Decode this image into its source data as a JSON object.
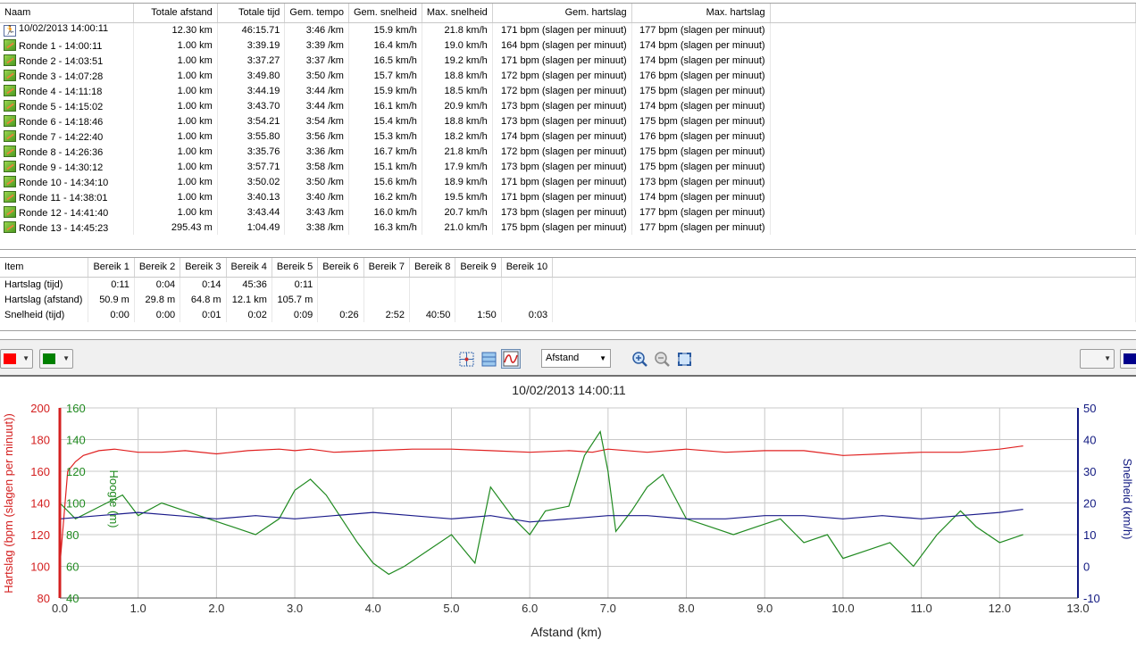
{
  "laps": {
    "columns": [
      "Naam",
      "Totale afstand",
      "Totale tijd",
      "Gem. tempo",
      "Gem. snelheid",
      "Max. snelheid",
      "Gem. hartslag",
      "Max. hartslag"
    ],
    "rows": [
      {
        "name": "10/02/2013 14:00:11",
        "dist": "12.30 km",
        "time": "46:15.71",
        "pace": "3:46 /km",
        "avg_speed": "15.9 km/h",
        "max_speed": "21.8 km/h",
        "avg_hr": "171 bpm (slagen per minuut)",
        "max_hr": "177 bpm (slagen per minuut)",
        "icon": "runner-icon"
      },
      {
        "name": "Ronde 1 - 14:00:11",
        "dist": "1.00 km",
        "time": "3:39.19",
        "pace": "3:39 /km",
        "avg_speed": "16.4 km/h",
        "max_speed": "19.0 km/h",
        "avg_hr": "164 bpm (slagen per minuut)",
        "max_hr": "174 bpm (slagen per minuut)",
        "icon": "lap-icon"
      },
      {
        "name": "Ronde 2 - 14:03:51",
        "dist": "1.00 km",
        "time": "3:37.27",
        "pace": "3:37 /km",
        "avg_speed": "16.5 km/h",
        "max_speed": "19.2 km/h",
        "avg_hr": "171 bpm (slagen per minuut)",
        "max_hr": "174 bpm (slagen per minuut)",
        "icon": "lap-icon"
      },
      {
        "name": "Ronde 3 - 14:07:28",
        "dist": "1.00 km",
        "time": "3:49.80",
        "pace": "3:50 /km",
        "avg_speed": "15.7 km/h",
        "max_speed": "18.8 km/h",
        "avg_hr": "172 bpm (slagen per minuut)",
        "max_hr": "176 bpm (slagen per minuut)",
        "icon": "lap-icon"
      },
      {
        "name": "Ronde 4 - 14:11:18",
        "dist": "1.00 km",
        "time": "3:44.19",
        "pace": "3:44 /km",
        "avg_speed": "15.9 km/h",
        "max_speed": "18.5 km/h",
        "avg_hr": "172 bpm (slagen per minuut)",
        "max_hr": "175 bpm (slagen per minuut)",
        "icon": "lap-icon"
      },
      {
        "name": "Ronde 5 - 14:15:02",
        "dist": "1.00 km",
        "time": "3:43.70",
        "pace": "3:44 /km",
        "avg_speed": "16.1 km/h",
        "max_speed": "20.9 km/h",
        "avg_hr": "173 bpm (slagen per minuut)",
        "max_hr": "174 bpm (slagen per minuut)",
        "icon": "lap-icon"
      },
      {
        "name": "Ronde 6 - 14:18:46",
        "dist": "1.00 km",
        "time": "3:54.21",
        "pace": "3:54 /km",
        "avg_speed": "15.4 km/h",
        "max_speed": "18.8 km/h",
        "avg_hr": "173 bpm (slagen per minuut)",
        "max_hr": "175 bpm (slagen per minuut)",
        "icon": "lap-icon"
      },
      {
        "name": "Ronde 7 - 14:22:40",
        "dist": "1.00 km",
        "time": "3:55.80",
        "pace": "3:56 /km",
        "avg_speed": "15.3 km/h",
        "max_speed": "18.2 km/h",
        "avg_hr": "174 bpm (slagen per minuut)",
        "max_hr": "176 bpm (slagen per minuut)",
        "icon": "lap-icon"
      },
      {
        "name": "Ronde 8 - 14:26:36",
        "dist": "1.00 km",
        "time": "3:35.76",
        "pace": "3:36 /km",
        "avg_speed": "16.7 km/h",
        "max_speed": "21.8 km/h",
        "avg_hr": "172 bpm (slagen per minuut)",
        "max_hr": "175 bpm (slagen per minuut)",
        "icon": "lap-icon"
      },
      {
        "name": "Ronde 9 - 14:30:12",
        "dist": "1.00 km",
        "time": "3:57.71",
        "pace": "3:58 /km",
        "avg_speed": "15.1 km/h",
        "max_speed": "17.9 km/h",
        "avg_hr": "173 bpm (slagen per minuut)",
        "max_hr": "175 bpm (slagen per minuut)",
        "icon": "lap-icon"
      },
      {
        "name": "Ronde 10 - 14:34:10",
        "dist": "1.00 km",
        "time": "3:50.02",
        "pace": "3:50 /km",
        "avg_speed": "15.6 km/h",
        "max_speed": "18.9 km/h",
        "avg_hr": "171 bpm (slagen per minuut)",
        "max_hr": "173 bpm (slagen per minuut)",
        "icon": "lap-icon"
      },
      {
        "name": "Ronde 11 - 14:38:01",
        "dist": "1.00 km",
        "time": "3:40.13",
        "pace": "3:40 /km",
        "avg_speed": "16.2 km/h",
        "max_speed": "19.5 km/h",
        "avg_hr": "171 bpm (slagen per minuut)",
        "max_hr": "174 bpm (slagen per minuut)",
        "icon": "lap-icon"
      },
      {
        "name": "Ronde 12 - 14:41:40",
        "dist": "1.00 km",
        "time": "3:43.44",
        "pace": "3:43 /km",
        "avg_speed": "16.0 km/h",
        "max_speed": "20.7 km/h",
        "avg_hr": "173 bpm (slagen per minuut)",
        "max_hr": "177 bpm (slagen per minuut)",
        "icon": "lap-icon"
      },
      {
        "name": "Ronde 13 - 14:45:23",
        "dist": "295.43 m",
        "time": "1:04.49",
        "pace": "3:38 /km",
        "avg_speed": "16.3 km/h",
        "max_speed": "21.0 km/h",
        "avg_hr": "175 bpm (slagen per minuut)",
        "max_hr": "177 bpm (slagen per minuut)",
        "icon": "lap-icon"
      }
    ]
  },
  "zones": {
    "columns": [
      "Item",
      "Bereik 1",
      "Bereik 2",
      "Bereik 3",
      "Bereik 4",
      "Bereik 5",
      "Bereik 6",
      "Bereik 7",
      "Bereik 8",
      "Bereik 9",
      "Bereik 10"
    ],
    "rows": [
      [
        "Hartslag (tijd)",
        "0:11",
        "0:04",
        "0:14",
        "45:36",
        "0:11",
        "",
        "",
        "",
        "",
        ""
      ],
      [
        "Hartslag (afstand)",
        "50.9 m",
        "29.8 m",
        "64.8 m",
        "12.1 km",
        "105.7 m",
        "",
        "",
        "",
        "",
        ""
      ],
      [
        "Snelheid (tijd)",
        "0:00",
        "0:00",
        "0:01",
        "0:02",
        "0:09",
        "0:26",
        "2:52",
        "40:50",
        "1:50",
        "0:03"
      ]
    ]
  },
  "toolbar": {
    "left_color_1": "#ff0000",
    "left_color_2": "#008000",
    "right_color_2": "#00008b",
    "x_axis_select": "Afstand",
    "icons": [
      "crosshair-icon",
      "grid-icon",
      "smooth-icon",
      "zoom-in-icon",
      "zoom-out-icon",
      "zoom-fit-icon"
    ]
  },
  "chart_data": {
    "type": "line",
    "title": "10/02/2013 14:00:11",
    "xlabel": "Afstand (km)",
    "xlim": [
      0,
      13
    ],
    "x_ticks": [
      "0.0",
      "1.0",
      "2.0",
      "3.0",
      "4.0",
      "5.0",
      "6.0",
      "7.0",
      "8.0",
      "9.0",
      "10.0",
      "11.0",
      "12.0",
      "13.0"
    ],
    "grid": true,
    "axes": [
      {
        "label": "Hartslag (bpm (slagen per minuut))",
        "side": "left",
        "color": "#d42020",
        "ylim": [
          80,
          200
        ],
        "ticks": [
          "200",
          "180",
          "160",
          "140",
          "120",
          "100",
          "80"
        ]
      },
      {
        "label": "Hoogte (m)",
        "side": "left-inner",
        "color": "#208a20",
        "ylim": [
          40,
          160
        ],
        "ticks": [
          "160",
          "140",
          "120",
          "100",
          "80",
          "60",
          "40"
        ]
      },
      {
        "label": "Snelheid (km/h)",
        "side": "right",
        "color": "#101880",
        "ylim": [
          -10,
          50
        ],
        "ticks": [
          "50",
          "40",
          "30",
          "20",
          "10",
          "0",
          "-10"
        ]
      }
    ],
    "series": [
      {
        "axis": 0,
        "color": "#e02020",
        "x": [
          0,
          0.1,
          0.2,
          0.3,
          0.5,
          0.7,
          1,
          1.3,
          1.6,
          2,
          2.4,
          2.8,
          3,
          3.2,
          3.5,
          4,
          4.5,
          5,
          5.5,
          6,
          6.5,
          6.8,
          7,
          7.5,
          8,
          8.5,
          9,
          9.5,
          10,
          10.5,
          11,
          11.5,
          12,
          12.3
        ],
        "values": [
          100,
          160,
          166,
          170,
          173,
          174,
          172,
          172,
          173,
          171,
          173,
          174,
          173,
          174,
          172,
          173,
          174,
          174,
          173,
          172,
          173,
          172,
          174,
          172,
          174,
          172,
          173,
          173,
          170,
          171,
          172,
          172,
          174,
          176
        ]
      },
      {
        "axis": 1,
        "color": "#208a20",
        "x": [
          0,
          0.2,
          0.4,
          0.6,
          0.8,
          1.0,
          1.3,
          1.6,
          1.9,
          2.2,
          2.5,
          2.8,
          3.0,
          3.2,
          3.4,
          3.6,
          3.8,
          4.0,
          4.2,
          4.4,
          4.7,
          5.0,
          5.3,
          5.5,
          5.8,
          6.0,
          6.2,
          6.5,
          6.7,
          6.9,
          7.0,
          7.1,
          7.3,
          7.5,
          7.7,
          8.0,
          8.3,
          8.6,
          8.9,
          9.2,
          9.5,
          9.8,
          10.0,
          10.3,
          10.6,
          10.9,
          11.2,
          11.5,
          11.7,
          12.0,
          12.3
        ],
        "values": [
          100,
          90,
          95,
          100,
          105,
          92,
          100,
          95,
          90,
          85,
          80,
          90,
          108,
          115,
          105,
          90,
          75,
          62,
          55,
          60,
          70,
          80,
          62,
          110,
          90,
          80,
          95,
          98,
          130,
          145,
          120,
          82,
          95,
          110,
          118,
          90,
          85,
          80,
          85,
          90,
          75,
          80,
          65,
          70,
          75,
          60,
          80,
          95,
          85,
          75,
          80
        ]
      },
      {
        "axis": 2,
        "color": "#1a1a8a",
        "x": [
          0,
          0.5,
          1,
          1.5,
          2,
          2.5,
          3,
          3.5,
          4,
          4.5,
          5,
          5.5,
          6,
          6.5,
          7,
          7.5,
          8,
          8.5,
          9,
          9.5,
          10,
          10.5,
          11,
          11.5,
          12,
          12.3
        ],
        "values": [
          15,
          16,
          17,
          16,
          15,
          16,
          15,
          16,
          17,
          16,
          15,
          16,
          14,
          15,
          16,
          16,
          15,
          15,
          16,
          16,
          15,
          16,
          15,
          16,
          17,
          18
        ]
      }
    ]
  }
}
